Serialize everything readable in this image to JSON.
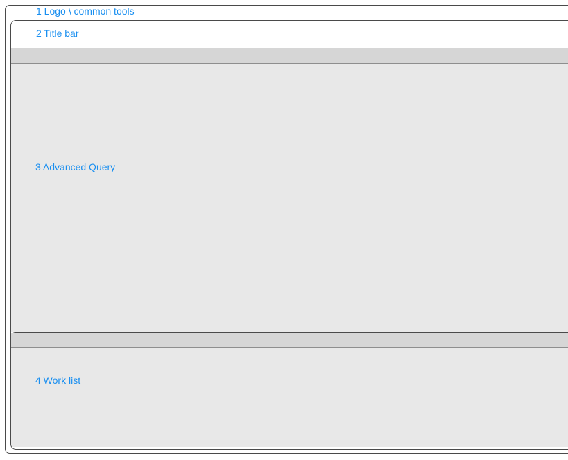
{
  "logo_bar": {
    "label": "1 Logo \\ common tools"
  },
  "title_bar": {
    "label": "2 Title bar"
  },
  "advanced_query": {
    "label": "3 Advanced Query"
  },
  "work_list": {
    "label": "4 Work list"
  },
  "colors": {
    "label": "#1a8ff0",
    "panel": "#e8e8e8",
    "panel_header": "#d6d6d6",
    "border": "#4a4a4a"
  }
}
